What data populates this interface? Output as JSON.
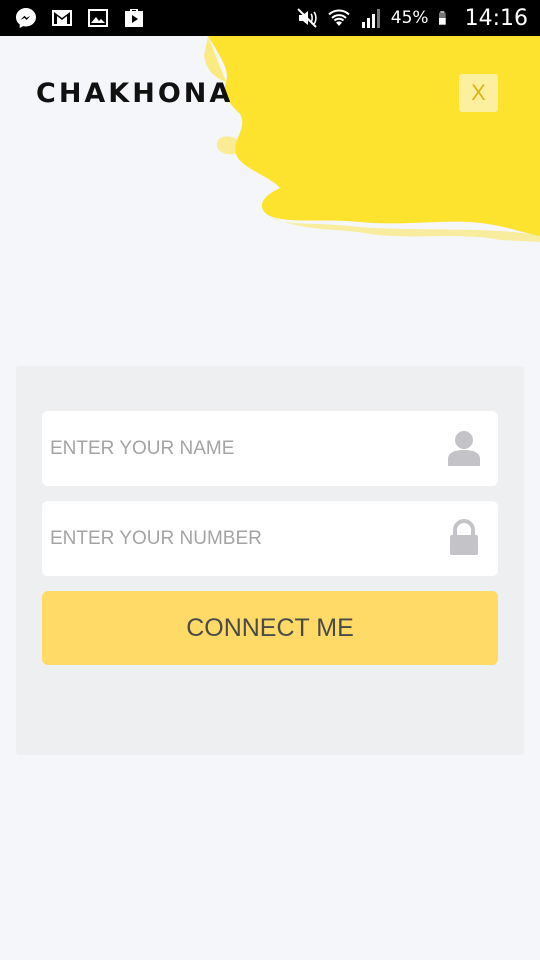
{
  "status_bar": {
    "icons_left": [
      "messenger-icon",
      "gmail-icon",
      "gallery-icon",
      "play-store-icon"
    ],
    "icons_right": [
      "mute-icon",
      "wifi-icon",
      "signal-icon",
      "battery-icon"
    ],
    "battery": "45%",
    "time": "14:16"
  },
  "brand": {
    "logo_text": "CHAKHONA",
    "accent": "#fde22e"
  },
  "close": {
    "label": "X"
  },
  "form": {
    "name_placeholder": "ENTER YOUR NAME",
    "number_placeholder": "ENTER YOUR NUMBER",
    "name_icon": "user-icon",
    "number_icon": "lock-icon",
    "submit_label": "CONNECT ME"
  }
}
